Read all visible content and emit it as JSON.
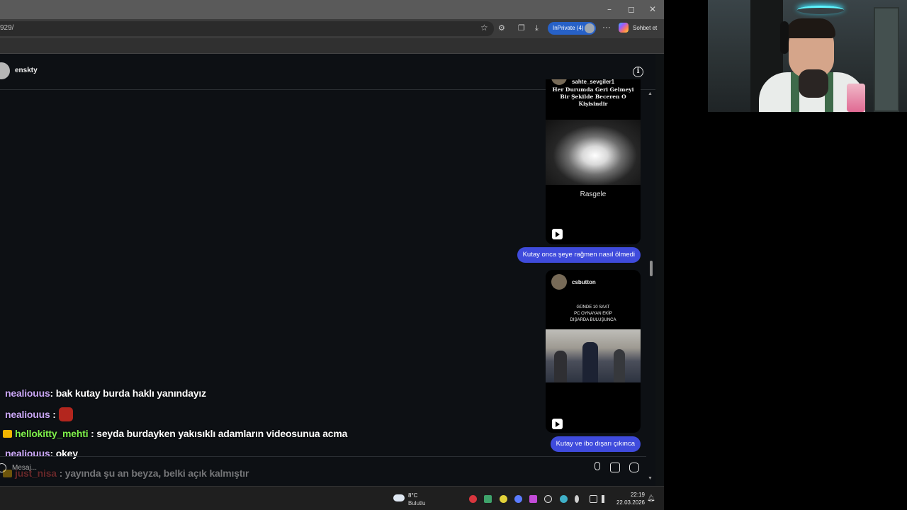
{
  "browser": {
    "url": "929/",
    "inprivate_label": "InPrivate (4)",
    "chat_button_label": "Sohbet et",
    "window_controls": [
      "–",
      "◻",
      "✕"
    ],
    "toolbar_icons": [
      "star-icon",
      "extensions-icon",
      "collections-icon",
      "download-icon",
      "more-icon"
    ]
  },
  "dm": {
    "username": "enskty",
    "reels": [
      {
        "user": "sahte_sevgiler1",
        "caption": [
          "Her Durumda Geri Gelmeyi",
          "Bir Şekilde Beceren O",
          "Kişisindir"
        ],
        "overlay_text": "Rasgele"
      },
      {
        "user": "csbutton",
        "caption": [
          "GÜNDE 10 SAAT",
          "PC OYNAYAN EKİP",
          "DIŞARDA BULUŞUNCA"
        ]
      }
    ],
    "messages": [
      "Kutay onca şeye rağmen nasıl ölmedi",
      "Kutay ve ibo dışarı çıkınca"
    ],
    "composer_placeholder": "Mesaj..."
  },
  "stream_chat": [
    {
      "user": "nealiouus",
      "text": ": bak kutay burda haklı yanındayız"
    },
    {
      "user": "nealiouus",
      "text": " :"
    },
    {
      "user": "hellokitty_mehti",
      "text": ": seyda burdayken yakısıklı adamların videosunua acma"
    },
    {
      "user": "nealiouus",
      "text": ": okey"
    },
    {
      "user": "just_nisa",
      "text": ": yayında şu an beyza, belki açık kalmıştır"
    }
  ],
  "taskbar": {
    "temperature": "8°C",
    "condition": "Bulutlu",
    "time": "22:19",
    "date": "22.03.2026"
  },
  "colors": {
    "bubble": "#3f4bdc",
    "inprivate": "#2761c7",
    "chat_user_purple": "#c9a7f5",
    "chat_user_green": "#7ef04b",
    "chat_user_red": "#e04848"
  }
}
